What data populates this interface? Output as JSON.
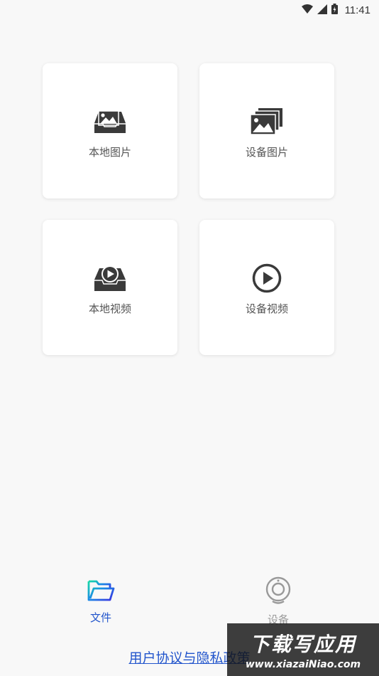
{
  "status_bar": {
    "time": "11:41"
  },
  "cards": [
    {
      "label": "本地图片",
      "icon": "local-image-icon"
    },
    {
      "label": "设备图片",
      "icon": "device-images-icon"
    },
    {
      "label": "本地视频",
      "icon": "local-video-icon"
    },
    {
      "label": "设备视频",
      "icon": "device-video-icon"
    }
  ],
  "tabs": [
    {
      "label": "文件",
      "icon": "folder-icon",
      "active": true
    },
    {
      "label": "设备",
      "icon": "camera-icon",
      "active": false
    }
  ],
  "privacy_link": "用户协议与隐私政策",
  "watermark": {
    "title": "下载写应用",
    "url": "www.xiazaiNiao.com"
  },
  "colors": {
    "accent": "#2255cc",
    "icon": "#3a3a3a",
    "inactive": "#999999",
    "background": "#f8f8f8"
  }
}
